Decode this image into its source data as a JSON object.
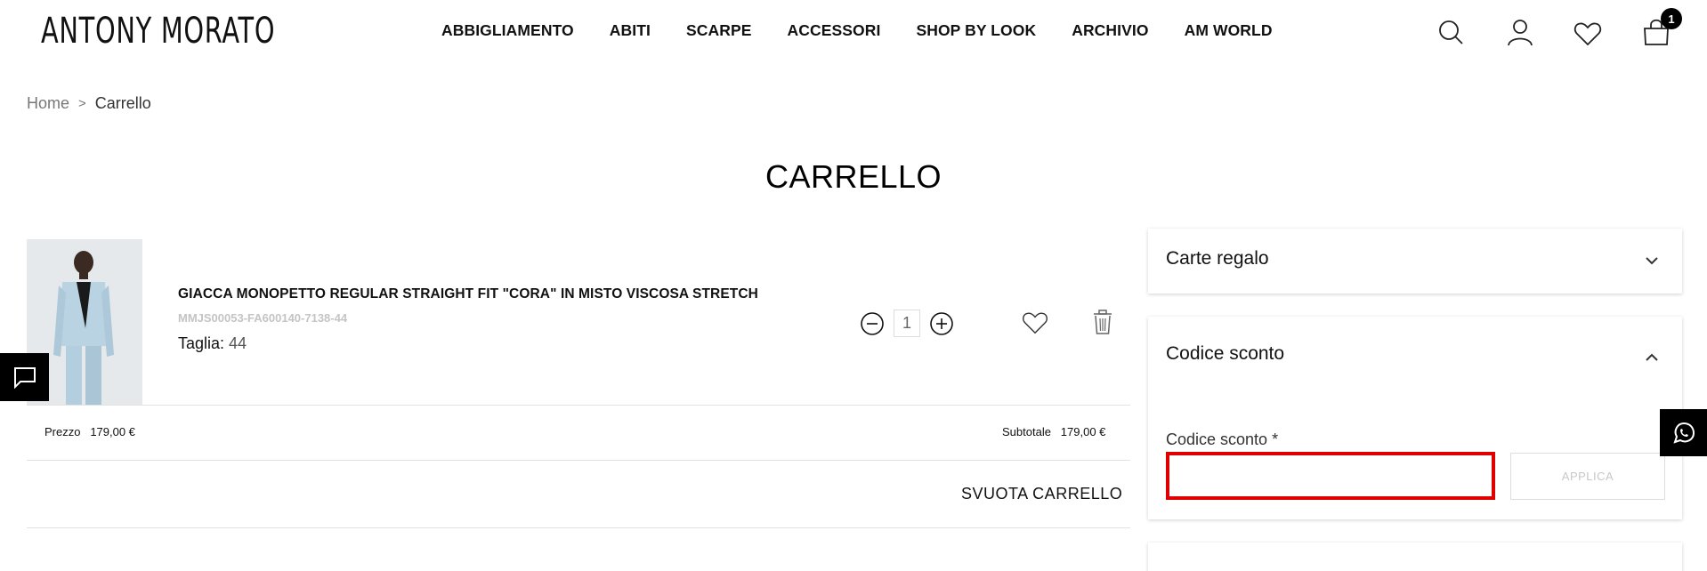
{
  "header": {
    "logo": "ANTONY MORATO",
    "nav": [
      "ABBIGLIAMENTO",
      "ABITI",
      "SCARPE",
      "ACCESSORI",
      "SHOP BY LOOK",
      "ARCHIVIO",
      "AM WORLD"
    ],
    "icons": [
      "search-icon",
      "user-icon",
      "heart-icon",
      "bag-icon"
    ],
    "cart_count": "1"
  },
  "breadcrumb": {
    "home": "Home",
    "separator": ">",
    "current": "Carrello"
  },
  "page_title": "CARRELLO",
  "item": {
    "name": "GIACCA MONOPETTO REGULAR STRAIGHT FIT \"CORA\" IN MISTO VISCOSA STRETCH",
    "sku": "MMJS00053-FA600140-7138-44",
    "size_label": "Taglia:",
    "size_value": "44",
    "quantity": "1",
    "price_label": "Prezzo",
    "price": "179,00 €",
    "subtotal_label": "Subtotale",
    "subtotal": "179,00 €"
  },
  "empty_cart_label": "SVUOTA CARRELLO",
  "sidebar": {
    "gift_cards_title": "Carte regalo",
    "discount_title": "Codice sconto",
    "discount_field_label": "Codice sconto *",
    "discount_placeholder": "",
    "apply_label": "APPLICA"
  },
  "colors": {
    "accent_error": "#e00000",
    "black": "#000000"
  }
}
